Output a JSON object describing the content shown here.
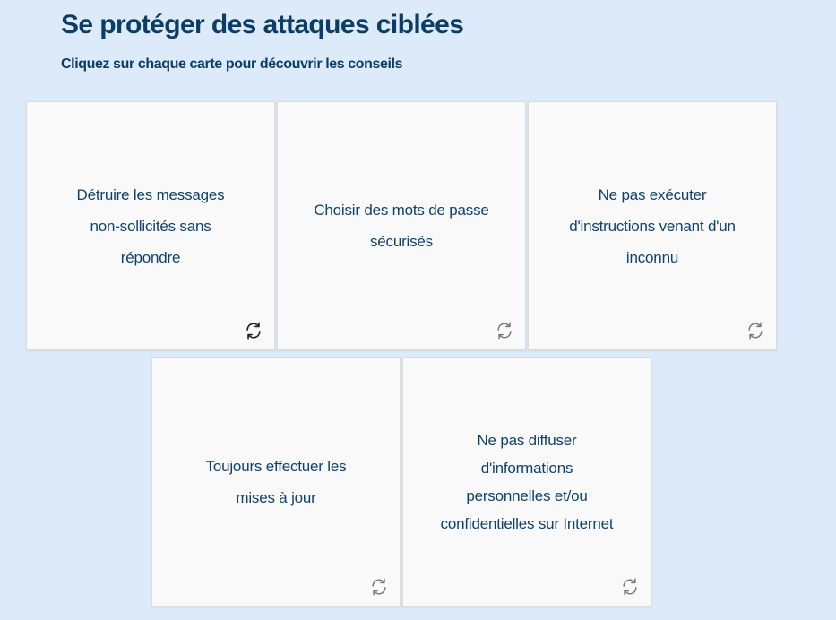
{
  "header": {
    "title": "Se protéger des attaques ciblées",
    "subtitle": "Cliquez sur chaque carte pour découvrir les conseils"
  },
  "cards": [
    {
      "text": "Détruire les messages non-sollicités sans répondre",
      "icon": "flip-icon"
    },
    {
      "text": "Choisir des mots de passe sécurisés",
      "icon": "flip-icon"
    },
    {
      "text": "Ne pas exécuter d'instructions venant d'un inconnu",
      "icon": "flip-icon"
    },
    {
      "text": "Toujours effectuer les mises à jour",
      "icon": "flip-icon"
    },
    {
      "text": "Ne pas diffuser d'informations personnelles et/ou confidentielles sur Internet",
      "icon": "flip-icon"
    }
  ],
  "colors": {
    "background": "#ddeaf9",
    "card": "#f9f9f9",
    "text": "#0c3d65"
  }
}
